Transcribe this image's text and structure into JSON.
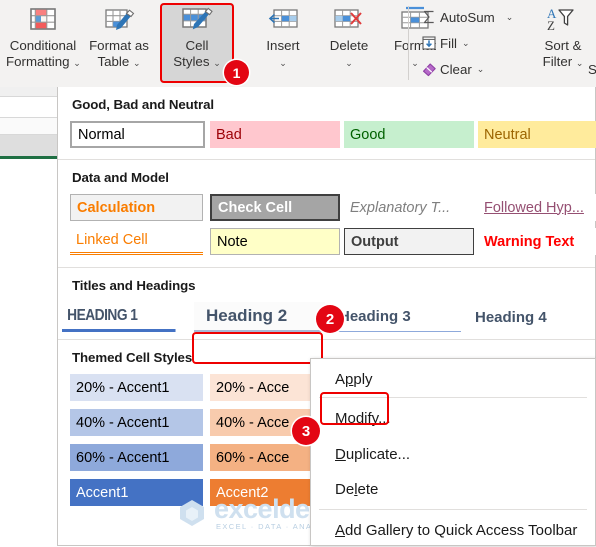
{
  "ribbon": {
    "buttons": [
      {
        "name": "conditional-formatting",
        "line1": "Conditional",
        "line2": "Formatting",
        "icon": "conditional-formatting-icon",
        "chevron": "⌄"
      },
      {
        "name": "format-as-table",
        "line1": "Format as",
        "line2": "Table",
        "icon": "format-as-table-icon",
        "chevron": "⌄"
      },
      {
        "name": "cell-styles",
        "line1": "Cell",
        "line2": "Styles",
        "icon": "cell-styles-icon",
        "chevron": "⌄"
      },
      {
        "name": "insert",
        "line1": "Insert",
        "line2": "",
        "icon": "insert-cells-icon",
        "chevron": "⌄"
      },
      {
        "name": "delete",
        "line1": "Delete",
        "line2": "",
        "icon": "delete-cells-icon",
        "chevron": "⌄"
      },
      {
        "name": "format",
        "line1": "Format",
        "line2": "",
        "icon": "format-cells-icon",
        "chevron": "⌄"
      }
    ],
    "editing": [
      {
        "name": "autosum",
        "label": "AutoSum",
        "icon": "sigma-icon",
        "chevron": "⌄"
      },
      {
        "name": "fill",
        "label": "Fill",
        "icon": "fill-down-icon",
        "chevron": "⌄"
      },
      {
        "name": "clear",
        "label": "Clear",
        "icon": "eraser-icon",
        "chevron": "⌄"
      }
    ],
    "sort_filter": {
      "line1": "Sort &",
      "line2": "Filter",
      "icon": "sort-filter-icon",
      "chevron": "⌄"
    },
    "find_select_partial": "S"
  },
  "badges": {
    "one": "1",
    "two": "2",
    "three": "3"
  },
  "gallery": {
    "sections": [
      {
        "title": "Good, Bad and Neutral",
        "styles": [
          {
            "label": "Normal",
            "bg": "#ffffff",
            "fg": "#000000",
            "border": "#a6a6a6"
          },
          {
            "label": "Bad",
            "bg": "#ffc7ce",
            "fg": "#9c0006",
            "border": "none"
          },
          {
            "label": "Good",
            "bg": "#c6efce",
            "fg": "#006100",
            "border": "none"
          },
          {
            "label": "Neutral",
            "bg": "#ffeb9c",
            "fg": "#9c6500",
            "border": "none"
          }
        ]
      },
      {
        "title": "Data and Model",
        "styles": [
          {
            "label": "Calculation",
            "bg": "#f2f2f2",
            "fg": "#fa7d00",
            "border": "#b2b2b2",
            "bold": true
          },
          {
            "label": "Check Cell",
            "bg": "#a5a5a5",
            "fg": "#ffffff",
            "border": "#3f3f3f",
            "bold": true
          },
          {
            "label": "Explanatory T...",
            "bg": "#ffffff",
            "fg": "#7f7f7f",
            "border": "none",
            "italic": true
          },
          {
            "label": "Followed Hyp...",
            "bg": "#ffffff",
            "fg": "#954f72",
            "border": "none",
            "underline": true
          },
          {
            "label": "Linked Cell",
            "bg": "#ffffff",
            "fg": "#fa7d00",
            "border": "none",
            "double_underline": "#fa7d00"
          },
          {
            "label": "Note",
            "bg": "#ffffc7",
            "fg": "#000000",
            "border": "#b2b2b2"
          },
          {
            "label": "Output",
            "bg": "#f2f2f2",
            "fg": "#3f3f3f",
            "border": "#3f3f3f",
            "bold": true
          },
          {
            "label": "Warning Text",
            "bg": "#ffffff",
            "fg": "#ff0000",
            "border": "none"
          }
        ]
      },
      {
        "title": "Titles and Headings",
        "styles": [
          {
            "label": "HEADING 1",
            "bg": "#ffffff",
            "fg": "#44546a",
            "border": "none",
            "bold": true,
            "rule": "#4472c4",
            "rule_h": 3
          },
          {
            "label": "Heading 2",
            "bg": "#ffffff",
            "fg": "#44546a",
            "border": "none",
            "bold": true,
            "rule": "#a9b8d4",
            "rule_h": 2
          },
          {
            "label": "Heading 3",
            "bg": "#ffffff",
            "fg": "#44546a",
            "border": "none",
            "bold": true,
            "rule": "#8ea9db",
            "rule_h": 1
          },
          {
            "label": "Heading 4",
            "bg": "#ffffff",
            "fg": "#44546a",
            "border": "none",
            "bold": true
          }
        ]
      },
      {
        "title": "Themed Cell Styles",
        "styles": [
          {
            "label": "20% - Accent1",
            "bg": "#d9e1f2",
            "fg": "#000000",
            "border": "none"
          },
          {
            "label": "20% - Acce",
            "bg": "#fce4d6",
            "fg": "#000000",
            "border": "none"
          },
          {
            "label": "40% - Accent1",
            "bg": "#b4c6e7",
            "fg": "#000000",
            "border": "none"
          },
          {
            "label": "40% - Acce",
            "bg": "#f8cbad",
            "fg": "#000000",
            "border": "none"
          },
          {
            "label": "60% - Accent1",
            "bg": "#8ea9db",
            "fg": "#000000",
            "border": "none"
          },
          {
            "label": "60% - Acce",
            "bg": "#f4b183",
            "fg": "#000000",
            "border": "none"
          },
          {
            "label": "Accent1",
            "bg": "#4472c4",
            "fg": "#ffffff",
            "border": "none"
          },
          {
            "label": "Accent2",
            "bg": "#ed7d31",
            "fg": "#ffffff",
            "border": "none"
          }
        ]
      }
    ]
  },
  "context_menu": {
    "items": [
      {
        "name": "apply",
        "pre": "A",
        "key": "p",
        "post": "ply"
      },
      {
        "name": "modify",
        "pre": "",
        "key": "M",
        "post": "odify..."
      },
      {
        "name": "duplicate",
        "pre": "",
        "key": "D",
        "post": "uplicate..."
      },
      {
        "name": "delete",
        "pre": "De",
        "key": "l",
        "post": "ete"
      },
      {
        "name": "add-gallery-to-quick-access-toolbar",
        "pre": "",
        "key": "A",
        "post": "dd Gallery to Quick Access Toolbar"
      }
    ]
  },
  "watermark": {
    "name": "exceldemy",
    "tagline": "EXCEL · DATA · ANALYSIS"
  },
  "colors": {
    "accent": "#4472c4",
    "annotation": "#ee0000",
    "badge": "#e30613"
  }
}
